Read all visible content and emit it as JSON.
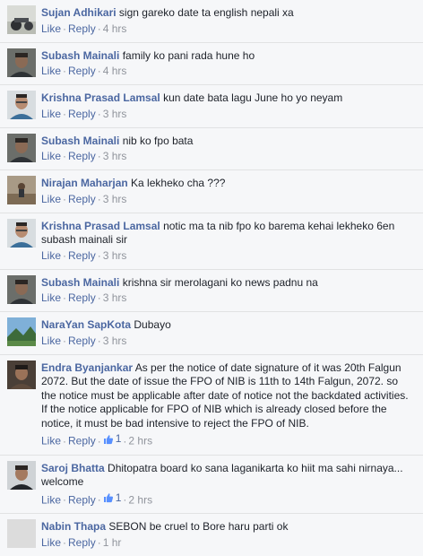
{
  "actions": {
    "like": "Like",
    "reply": "Reply",
    "sep": "·"
  },
  "comments": [
    {
      "author": "Sujan Adhikari",
      "text": "sign gareko date ta english nepali xa",
      "time": "4 hrs",
      "likes": null,
      "avatar": "avatar-sujan"
    },
    {
      "author": "Subash Mainali",
      "text": "family ko pani rada hune ho",
      "time": "4 hrs",
      "likes": null,
      "avatar": "avatar-subash"
    },
    {
      "author": "Krishna Prasad Lamsal",
      "text": "kun date bata lagu June ho yo neyam",
      "time": "3 hrs",
      "likes": null,
      "avatar": "avatar-krishna"
    },
    {
      "author": "Subash Mainali",
      "text": "nib ko fpo bata",
      "time": "3 hrs",
      "likes": null,
      "avatar": "avatar-subash"
    },
    {
      "author": "Nirajan Maharjan",
      "text": "Ka lekheko cha ???",
      "time": "3 hrs",
      "likes": null,
      "avatar": "avatar-nirajan"
    },
    {
      "author": "Krishna Prasad Lamsal",
      "text": "notic ma ta nib fpo ko barema kehai lekheko 6en subash mainali sir",
      "time": "3 hrs",
      "likes": null,
      "avatar": "avatar-krishna"
    },
    {
      "author": "Subash Mainali",
      "text": "krishna sir merolagani ko news padnu na",
      "time": "3 hrs",
      "likes": null,
      "avatar": "avatar-subash"
    },
    {
      "author": "NaraYan SapKota",
      "text": "Dubayo",
      "time": "3 hrs",
      "likes": null,
      "avatar": "avatar-narayan"
    },
    {
      "author": "Endra Byanjankar",
      "text": "As per the notice of date signature of it was 20th Falgun 2072. But the date of issue the FPO of NIB is 11th to 14th Falgun, 2072. so the notice must be applicable after date of notice not the backdated activities. If the notice applicable for FPO of NIB which is already closed before the notice, it must be bad intensive to reject the FPO of NIB.",
      "time": "2 hrs",
      "likes": "1",
      "avatar": "avatar-endra"
    },
    {
      "author": "Saroj Bhatta",
      "text": "Dhitopatra board ko sana laganikarta ko hiit ma sahi nirnaya... welcome",
      "time": "2 hrs",
      "likes": "1",
      "avatar": "avatar-saroj"
    },
    {
      "author": "Nabin Thapa",
      "text": "SEBON be cruel to Bore haru parti ok",
      "time": "1 hr",
      "likes": null,
      "avatar": "avatar-nabin"
    }
  ]
}
